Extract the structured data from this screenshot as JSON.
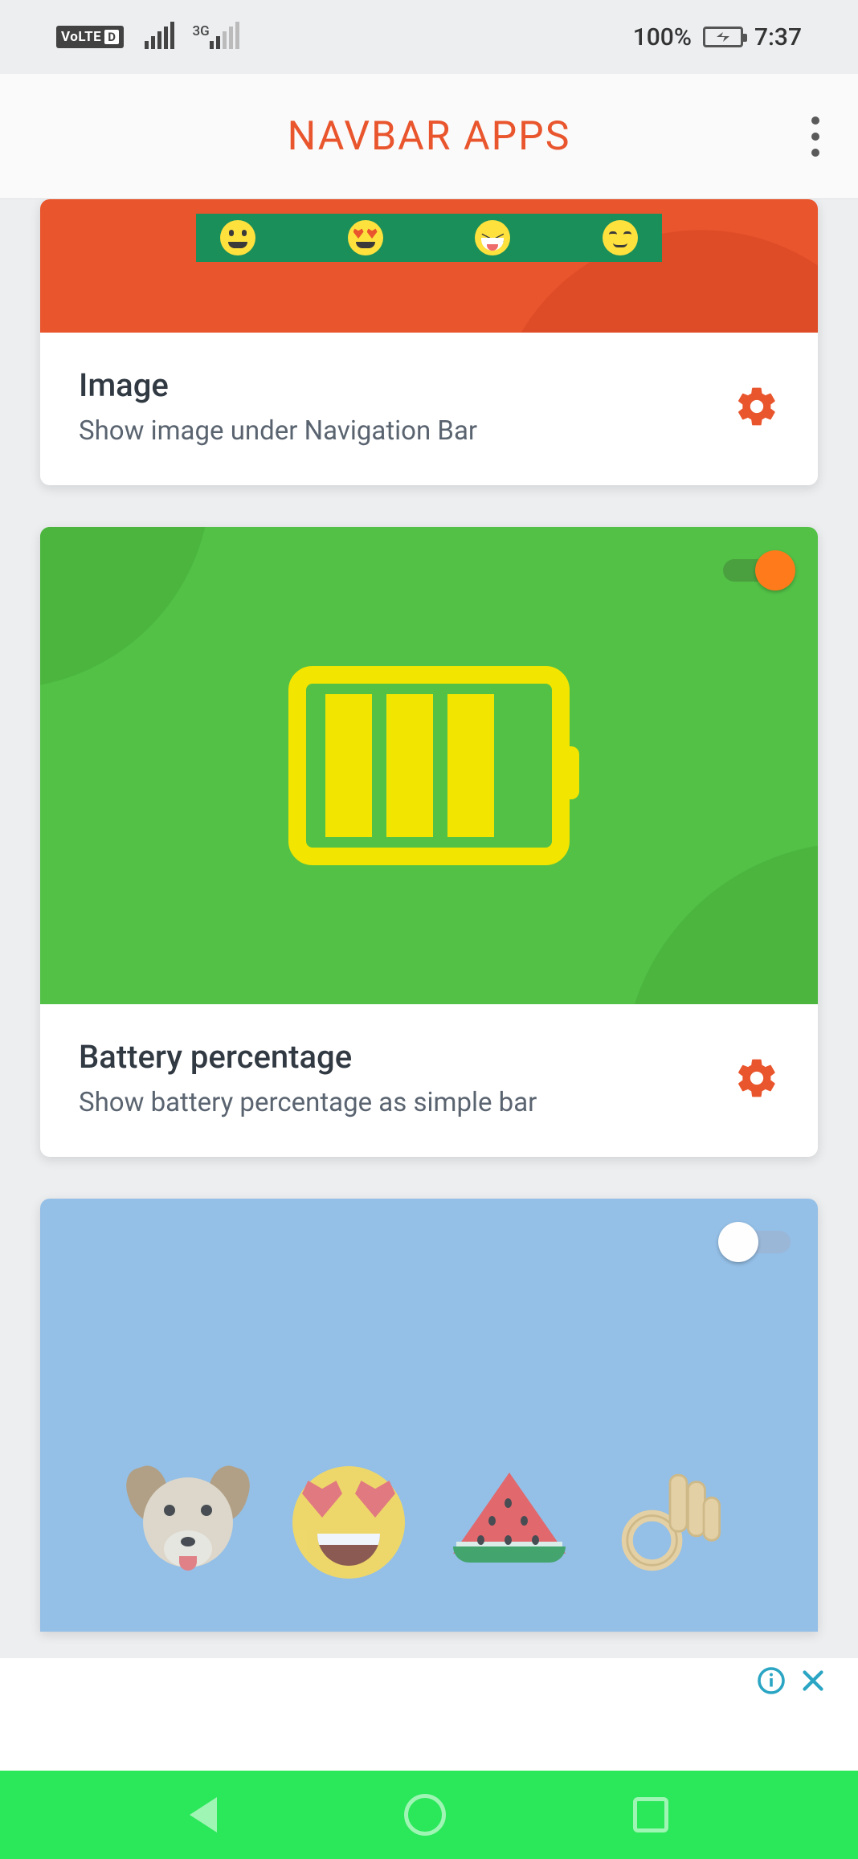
{
  "status_bar": {
    "battery_text": "100%",
    "clock": "7:37",
    "network_label": "3G",
    "volte_label": "VoLTE",
    "volte_sim": "D"
  },
  "app_bar": {
    "title": "NAVBAR APPS"
  },
  "cards": {
    "image": {
      "title": "Image",
      "subtitle": "Show image under Navigation Bar",
      "toggle_on": true,
      "demo_emoji": [
        "grin",
        "heart-eyes",
        "laugh",
        "content"
      ]
    },
    "battery": {
      "title": "Battery percentage",
      "subtitle": "Show battery percentage as simple bar",
      "toggle_on": true
    },
    "emoji": {
      "toggle_on": false,
      "items": [
        "dog",
        "heart-eyes",
        "watermelon",
        "ok-hand"
      ]
    }
  },
  "colors": {
    "accent": "#e9552d",
    "card2_bg": "#52c146",
    "card2_battery": "#f2e500",
    "card3_bg": "#94bfe6",
    "sys_nav": "#2be85a",
    "ad_tint": "#2aa5c3"
  }
}
